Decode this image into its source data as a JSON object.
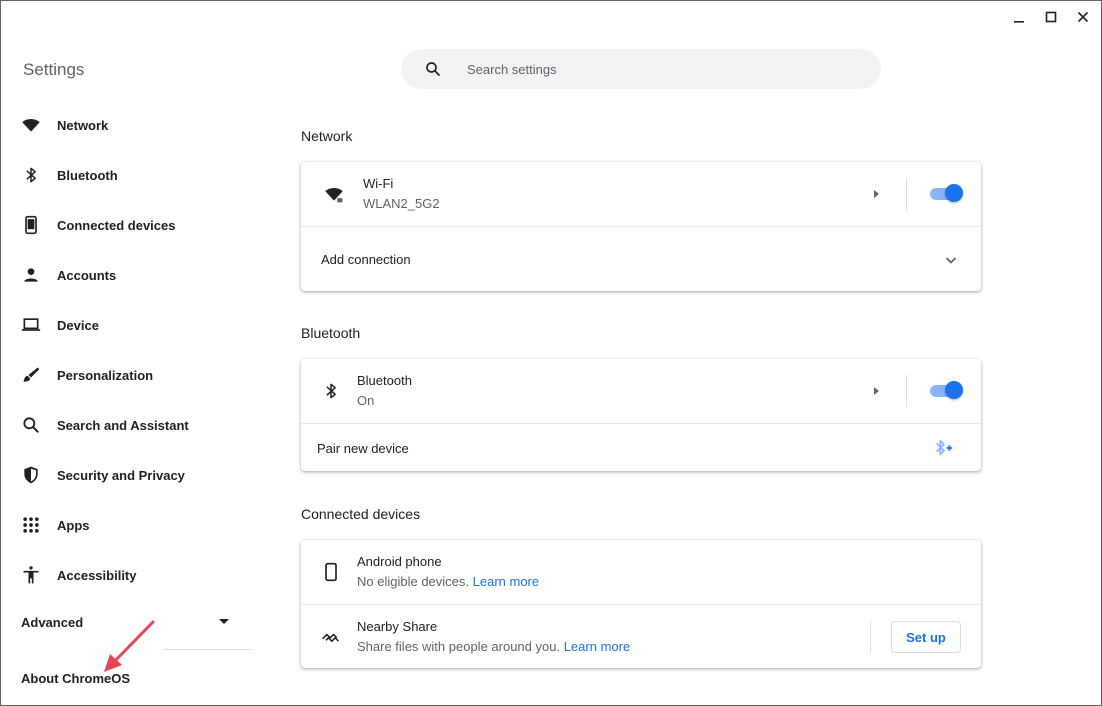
{
  "app": {
    "title": "Settings"
  },
  "search": {
    "placeholder": "Search settings"
  },
  "sidebar": {
    "items": [
      {
        "label": "Network",
        "icon": "wifi-icon"
      },
      {
        "label": "Bluetooth",
        "icon": "bluetooth-icon"
      },
      {
        "label": "Connected devices",
        "icon": "phone-icon"
      },
      {
        "label": "Accounts",
        "icon": "person-icon"
      },
      {
        "label": "Device",
        "icon": "laptop-icon"
      },
      {
        "label": "Personalization",
        "icon": "brush-icon"
      },
      {
        "label": "Search and Assistant",
        "icon": "search-icon"
      },
      {
        "label": "Security and Privacy",
        "icon": "shield-icon"
      },
      {
        "label": "Apps",
        "icon": "apps-grid-icon"
      },
      {
        "label": "Accessibility",
        "icon": "accessibility-icon"
      }
    ],
    "advanced_label": "Advanced",
    "about_label": "About ChromeOS"
  },
  "network": {
    "title": "Network",
    "wifi_label": "Wi-Fi",
    "wifi_ssid": "WLAN2_5G2",
    "wifi_enabled": true,
    "add_connection_label": "Add connection"
  },
  "bluetooth": {
    "title": "Bluetooth",
    "label": "Bluetooth",
    "status": "On",
    "enabled": true,
    "pair_label": "Pair new device"
  },
  "connected_devices": {
    "title": "Connected devices",
    "android_label": "Android phone",
    "android_status": "No eligible devices.",
    "android_link": "Learn more",
    "nearby_label": "Nearby Share",
    "nearby_desc": "Share files with people around you.",
    "nearby_link": "Learn more",
    "setup_label": "Set up"
  },
  "colors": {
    "accent": "#1a73e8",
    "toggle_track": "#8ab4f8",
    "annotation_arrow": "#e8445a"
  }
}
